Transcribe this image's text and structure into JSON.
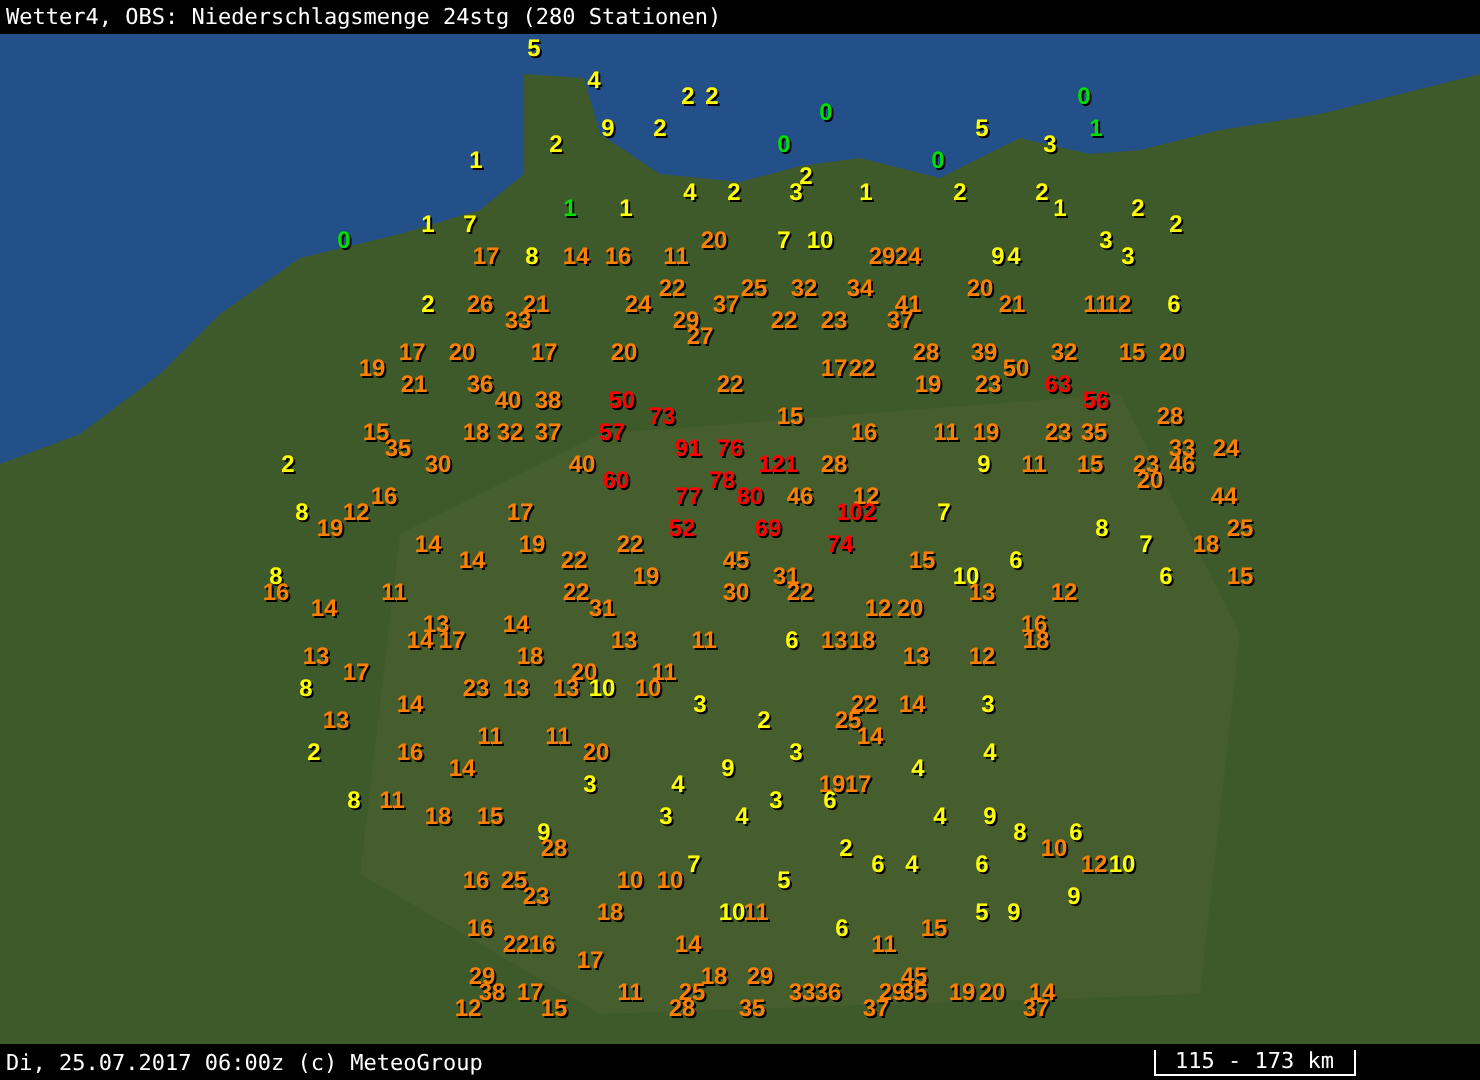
{
  "title": "Wetter4, OBS: Niederschlagsmenge 24stg (280 Stationen)",
  "stations": [
    {
      "value": "5",
      "color": "#ffff00"
    },
    {
      "value": "4",
      "color": "#ffff00"
    },
    {
      "value": "2",
      "color": "#ffff00"
    },
    {
      "value": "2",
      "color": "#ffff00"
    },
    {
      "value": "0",
      "color": "#00e000"
    },
    {
      "value": "0",
      "color": "#00e000"
    },
    {
      "value": "9",
      "color": "#ffff00"
    },
    {
      "value": "2",
      "color": "#ffff00"
    },
    {
      "value": "5",
      "color": "#ffff00"
    },
    {
      "value": "1",
      "color": "#00e000"
    },
    {
      "value": "2",
      "color": "#ffff00"
    },
    {
      "value": "0",
      "color": "#00e000"
    },
    {
      "value": "3",
      "color": "#ffff00"
    },
    {
      "value": "1",
      "color": "#ffff00"
    },
    {
      "value": "0",
      "color": "#00e000"
    },
    {
      "value": "2",
      "color": "#ffff00"
    },
    {
      "value": "4",
      "color": "#ffff00"
    },
    {
      "value": "2",
      "color": "#ffff00"
    },
    {
      "value": "3",
      "color": "#ffff00"
    },
    {
      "value": "1",
      "color": "#ffff00"
    },
    {
      "value": "2",
      "color": "#ffff00"
    },
    {
      "value": "2",
      "color": "#ffff00"
    },
    {
      "value": "1",
      "color": "#00e000"
    },
    {
      "value": "1",
      "color": "#ffff00"
    },
    {
      "value": "1",
      "color": "#ffff00"
    },
    {
      "value": "2",
      "color": "#ffff00"
    },
    {
      "value": "1",
      "color": "#ffff00"
    },
    {
      "value": "7",
      "color": "#ffff00"
    },
    {
      "value": "2",
      "color": "#ffff00"
    },
    {
      "value": "0",
      "color": "#00e000"
    },
    {
      "value": "20",
      "color": "#ff8000"
    },
    {
      "value": "7",
      "color": "#ffff00"
    },
    {
      "value": "10",
      "color": "#ffff00"
    },
    {
      "value": "3",
      "color": "#ffff00"
    },
    {
      "value": "17",
      "color": "#ff8000"
    },
    {
      "value": "8",
      "color": "#ffff00"
    },
    {
      "value": "14",
      "color": "#ff8000"
    },
    {
      "value": "16",
      "color": "#ff8000"
    },
    {
      "value": "11",
      "color": "#ff8000"
    },
    {
      "value": "29",
      "color": "#ff8000"
    },
    {
      "value": "24",
      "color": "#ff8000"
    },
    {
      "value": "9",
      "color": "#ffff00"
    },
    {
      "value": "4",
      "color": "#ffff00"
    },
    {
      "value": "3",
      "color": "#ffff00"
    },
    {
      "value": "22",
      "color": "#ff8000"
    },
    {
      "value": "25",
      "color": "#ff8000"
    },
    {
      "value": "32",
      "color": "#ff8000"
    },
    {
      "value": "34",
      "color": "#ff8000"
    },
    {
      "value": "20",
      "color": "#ff8000"
    },
    {
      "value": "2",
      "color": "#ffff00"
    },
    {
      "value": "26",
      "color": "#ff8000"
    },
    {
      "value": "21",
      "color": "#ff8000"
    },
    {
      "value": "24",
      "color": "#ff8000"
    },
    {
      "value": "37",
      "color": "#ff8000"
    },
    {
      "value": "41",
      "color": "#ff8000"
    },
    {
      "value": "21",
      "color": "#ff8000"
    },
    {
      "value": "11",
      "color": "#ff8000"
    },
    {
      "value": "12",
      "color": "#ff8000"
    },
    {
      "value": "6",
      "color": "#ffff00"
    },
    {
      "value": "33",
      "color": "#ff8000"
    },
    {
      "value": "29",
      "color": "#ff8000"
    },
    {
      "value": "22",
      "color": "#ff8000"
    },
    {
      "value": "23",
      "color": "#ff8000"
    },
    {
      "value": "37",
      "color": "#ff8000"
    },
    {
      "value": "27",
      "color": "#ff8000"
    },
    {
      "value": "17",
      "color": "#ff8000"
    },
    {
      "value": "20",
      "color": "#ff8000"
    },
    {
      "value": "17",
      "color": "#ff8000"
    },
    {
      "value": "20",
      "color": "#ff8000"
    },
    {
      "value": "28",
      "color": "#ff8000"
    },
    {
      "value": "39",
      "color": "#ff8000"
    },
    {
      "value": "32",
      "color": "#ff8000"
    },
    {
      "value": "15",
      "color": "#ff8000"
    },
    {
      "value": "20",
      "color": "#ff8000"
    },
    {
      "value": "19",
      "color": "#ff8000"
    },
    {
      "value": "17",
      "color": "#ff8000"
    },
    {
      "value": "22",
      "color": "#ff8000"
    },
    {
      "value": "50",
      "color": "#ff8000"
    },
    {
      "value": "21",
      "color": "#ff8000"
    },
    {
      "value": "36",
      "color": "#ff8000"
    },
    {
      "value": "22",
      "color": "#ff8000"
    },
    {
      "value": "19",
      "color": "#ff8000"
    },
    {
      "value": "23",
      "color": "#ff8000"
    },
    {
      "value": "63",
      "color": "#ff0000"
    },
    {
      "value": "40",
      "color": "#ff8000"
    },
    {
      "value": "38",
      "color": "#ff8000"
    },
    {
      "value": "50",
      "color": "#ff0000"
    },
    {
      "value": "56",
      "color": "#ff0000"
    },
    {
      "value": "73",
      "color": "#ff0000"
    },
    {
      "value": "15",
      "color": "#ff8000"
    },
    {
      "value": "28",
      "color": "#ff8000"
    },
    {
      "value": "15",
      "color": "#ff8000"
    },
    {
      "value": "18",
      "color": "#ff8000"
    },
    {
      "value": "32",
      "color": "#ff8000"
    },
    {
      "value": "37",
      "color": "#ff8000"
    },
    {
      "value": "57",
      "color": "#ff0000"
    },
    {
      "value": "16",
      "color": "#ff8000"
    },
    {
      "value": "11",
      "color": "#ff8000"
    },
    {
      "value": "19",
      "color": "#ff8000"
    },
    {
      "value": "23",
      "color": "#ff8000"
    },
    {
      "value": "35",
      "color": "#ff8000"
    },
    {
      "value": "35",
      "color": "#ff8000"
    },
    {
      "value": "91",
      "color": "#ff0000"
    },
    {
      "value": "76",
      "color": "#ff0000"
    },
    {
      "value": "33",
      "color": "#ff8000"
    },
    {
      "value": "24",
      "color": "#ff8000"
    },
    {
      "value": "2",
      "color": "#ffff00"
    },
    {
      "value": "30",
      "color": "#ff8000"
    },
    {
      "value": "40",
      "color": "#ff8000"
    },
    {
      "value": "121",
      "color": "#ff0000"
    },
    {
      "value": "28",
      "color": "#ff8000"
    },
    {
      "value": "9",
      "color": "#ffff00"
    },
    {
      "value": "11",
      "color": "#ff8000"
    },
    {
      "value": "15",
      "color": "#ff8000"
    },
    {
      "value": "23",
      "color": "#ff8000"
    },
    {
      "value": "46",
      "color": "#ff8000"
    },
    {
      "value": "60",
      "color": "#ff0000"
    },
    {
      "value": "78",
      "color": "#ff0000"
    },
    {
      "value": "20",
      "color": "#ff8000"
    },
    {
      "value": "16",
      "color": "#ff8000"
    },
    {
      "value": "77",
      "color": "#ff0000"
    },
    {
      "value": "80",
      "color": "#ff0000"
    },
    {
      "value": "46",
      "color": "#ff8000"
    },
    {
      "value": "12",
      "color": "#ff8000"
    },
    {
      "value": "44",
      "color": "#ff8000"
    },
    {
      "value": "8",
      "color": "#ffff00"
    },
    {
      "value": "12",
      "color": "#ff8000"
    },
    {
      "value": "17",
      "color": "#ff8000"
    },
    {
      "value": "102",
      "color": "#ff0000"
    },
    {
      "value": "7",
      "color": "#ffff00"
    },
    {
      "value": "19",
      "color": "#ff8000"
    },
    {
      "value": "52",
      "color": "#ff0000"
    },
    {
      "value": "69",
      "color": "#ff0000"
    },
    {
      "value": "8",
      "color": "#ffff00"
    },
    {
      "value": "25",
      "color": "#ff8000"
    },
    {
      "value": "14",
      "color": "#ff8000"
    },
    {
      "value": "19",
      "color": "#ff8000"
    },
    {
      "value": "22",
      "color": "#ff8000"
    },
    {
      "value": "74",
      "color": "#ff0000"
    },
    {
      "value": "7",
      "color": "#ffff00"
    },
    {
      "value": "18",
      "color": "#ff8000"
    },
    {
      "value": "14",
      "color": "#ff8000"
    },
    {
      "value": "22",
      "color": "#ff8000"
    },
    {
      "value": "45",
      "color": "#ff8000"
    },
    {
      "value": "15",
      "color": "#ff8000"
    },
    {
      "value": "6",
      "color": "#ffff00"
    },
    {
      "value": "8",
      "color": "#ffff00"
    },
    {
      "value": "19",
      "color": "#ff8000"
    },
    {
      "value": "31",
      "color": "#ff8000"
    },
    {
      "value": "10",
      "color": "#ffff00"
    },
    {
      "value": "6",
      "color": "#ffff00"
    },
    {
      "value": "15",
      "color": "#ff8000"
    },
    {
      "value": "16",
      "color": "#ff8000"
    },
    {
      "value": "11",
      "color": "#ff8000"
    },
    {
      "value": "22",
      "color": "#ff8000"
    },
    {
      "value": "30",
      "color": "#ff8000"
    },
    {
      "value": "22",
      "color": "#ff8000"
    },
    {
      "value": "13",
      "color": "#ff8000"
    },
    {
      "value": "12",
      "color": "#ff8000"
    },
    {
      "value": "14",
      "color": "#ff8000"
    },
    {
      "value": "31",
      "color": "#ff8000"
    },
    {
      "value": "12",
      "color": "#ff8000"
    },
    {
      "value": "20",
      "color": "#ff8000"
    },
    {
      "value": "13",
      "color": "#ff8000"
    },
    {
      "value": "14",
      "color": "#ff8000"
    },
    {
      "value": "16",
      "color": "#ff8000"
    },
    {
      "value": "14",
      "color": "#ff8000"
    },
    {
      "value": "17",
      "color": "#ff8000"
    },
    {
      "value": "13",
      "color": "#ff8000"
    },
    {
      "value": "11",
      "color": "#ff8000"
    },
    {
      "value": "6",
      "color": "#ffff00"
    },
    {
      "value": "13",
      "color": "#ff8000"
    },
    {
      "value": "18",
      "color": "#ff8000"
    },
    {
      "value": "18",
      "color": "#ff8000"
    },
    {
      "value": "13",
      "color": "#ff8000"
    },
    {
      "value": "18",
      "color": "#ff8000"
    },
    {
      "value": "13",
      "color": "#ff8000"
    },
    {
      "value": "12",
      "color": "#ff8000"
    },
    {
      "value": "17",
      "color": "#ff8000"
    },
    {
      "value": "20",
      "color": "#ff8000"
    },
    {
      "value": "11",
      "color": "#ff8000"
    },
    {
      "value": "8",
      "color": "#ffff00"
    },
    {
      "value": "23",
      "color": "#ff8000"
    },
    {
      "value": "13",
      "color": "#ff8000"
    },
    {
      "value": "13",
      "color": "#ff8000"
    },
    {
      "value": "10",
      "color": "#ffff00"
    },
    {
      "value": "10",
      "color": "#ff8000"
    },
    {
      "value": "14",
      "color": "#ff8000"
    },
    {
      "value": "3",
      "color": "#ffff00"
    },
    {
      "value": "22",
      "color": "#ff8000"
    },
    {
      "value": "14",
      "color": "#ff8000"
    },
    {
      "value": "3",
      "color": "#ffff00"
    },
    {
      "value": "13",
      "color": "#ff8000"
    },
    {
      "value": "2",
      "color": "#ffff00"
    },
    {
      "value": "25",
      "color": "#ff8000"
    },
    {
      "value": "11",
      "color": "#ff8000"
    },
    {
      "value": "11",
      "color": "#ff8000"
    },
    {
      "value": "14",
      "color": "#ff8000"
    },
    {
      "value": "2",
      "color": "#ffff00"
    },
    {
      "value": "16",
      "color": "#ff8000"
    },
    {
      "value": "20",
      "color": "#ff8000"
    },
    {
      "value": "3",
      "color": "#ffff00"
    },
    {
      "value": "4",
      "color": "#ffff00"
    },
    {
      "value": "14",
      "color": "#ff8000"
    },
    {
      "value": "9",
      "color": "#ffff00"
    },
    {
      "value": "4",
      "color": "#ffff00"
    },
    {
      "value": "3",
      "color": "#ffff00"
    },
    {
      "value": "4",
      "color": "#ffff00"
    },
    {
      "value": "19",
      "color": "#ff8000"
    },
    {
      "value": "17",
      "color": "#ff8000"
    },
    {
      "value": "8",
      "color": "#ffff00"
    },
    {
      "value": "11",
      "color": "#ff8000"
    },
    {
      "value": "3",
      "color": "#ffff00"
    },
    {
      "value": "6",
      "color": "#ffff00"
    },
    {
      "value": "18",
      "color": "#ff8000"
    },
    {
      "value": "15",
      "color": "#ff8000"
    },
    {
      "value": "3",
      "color": "#ffff00"
    },
    {
      "value": "4",
      "color": "#ffff00"
    },
    {
      "value": "4",
      "color": "#ffff00"
    },
    {
      "value": "9",
      "color": "#ffff00"
    },
    {
      "value": "9",
      "color": "#ffff00"
    },
    {
      "value": "8",
      "color": "#ffff00"
    },
    {
      "value": "6",
      "color": "#ffff00"
    },
    {
      "value": "28",
      "color": "#ff8000"
    },
    {
      "value": "2",
      "color": "#ffff00"
    },
    {
      "value": "10",
      "color": "#ff8000"
    },
    {
      "value": "7",
      "color": "#ffff00"
    },
    {
      "value": "6",
      "color": "#ffff00"
    },
    {
      "value": "4",
      "color": "#ffff00"
    },
    {
      "value": "6",
      "color": "#ffff00"
    },
    {
      "value": "12",
      "color": "#ff8000"
    },
    {
      "value": "10",
      "color": "#ffff00"
    },
    {
      "value": "16",
      "color": "#ff8000"
    },
    {
      "value": "25",
      "color": "#ff8000"
    },
    {
      "value": "10",
      "color": "#ff8000"
    },
    {
      "value": "10",
      "color": "#ff8000"
    },
    {
      "value": "5",
      "color": "#ffff00"
    },
    {
      "value": "23",
      "color": "#ff8000"
    },
    {
      "value": "9",
      "color": "#ffff00"
    },
    {
      "value": "18",
      "color": "#ff8000"
    },
    {
      "value": "10",
      "color": "#ffff00"
    },
    {
      "value": "11",
      "color": "#ff8000"
    },
    {
      "value": "5",
      "color": "#ffff00"
    },
    {
      "value": "9",
      "color": "#ffff00"
    },
    {
      "value": "16",
      "color": "#ff8000"
    },
    {
      "value": "6",
      "color": "#ffff00"
    },
    {
      "value": "15",
      "color": "#ff8000"
    },
    {
      "value": "22",
      "color": "#ff8000"
    },
    {
      "value": "16",
      "color": "#ff8000"
    },
    {
      "value": "14",
      "color": "#ff8000"
    },
    {
      "value": "11",
      "color": "#ff8000"
    },
    {
      "value": "17",
      "color": "#ff8000"
    },
    {
      "value": "29",
      "color": "#ff8000"
    },
    {
      "value": "18",
      "color": "#ff8000"
    },
    {
      "value": "29",
      "color": "#ff8000"
    },
    {
      "value": "45",
      "color": "#ff8000"
    },
    {
      "value": "38",
      "color": "#ff8000"
    },
    {
      "value": "17",
      "color": "#ff8000"
    },
    {
      "value": "11",
      "color": "#ff8000"
    },
    {
      "value": "25",
      "color": "#ff8000"
    },
    {
      "value": "33",
      "color": "#ff8000"
    },
    {
      "value": "36",
      "color": "#ff8000"
    },
    {
      "value": "29",
      "color": "#ff8000"
    },
    {
      "value": "35",
      "color": "#ff8000"
    },
    {
      "value": "19",
      "color": "#ff8000"
    },
    {
      "value": "20",
      "color": "#ff8000"
    },
    {
      "value": "14",
      "color": "#ff8000"
    },
    {
      "value": "12",
      "color": "#ff8000"
    },
    {
      "value": "15",
      "color": "#ff8000"
    },
    {
      "value": "28",
      "color": "#ff8000"
    },
    {
      "value": "35",
      "color": "#ff8000"
    },
    {
      "value": "37",
      "color": "#ff8000"
    },
    {
      "value": "37",
      "color": "#ff8000"
    }
  ],
  "footer": {
    "timestamp": "Di, 25.07.2017 06:00z (c) MeteoGroup",
    "scale": "115 - 173 km"
  }
}
